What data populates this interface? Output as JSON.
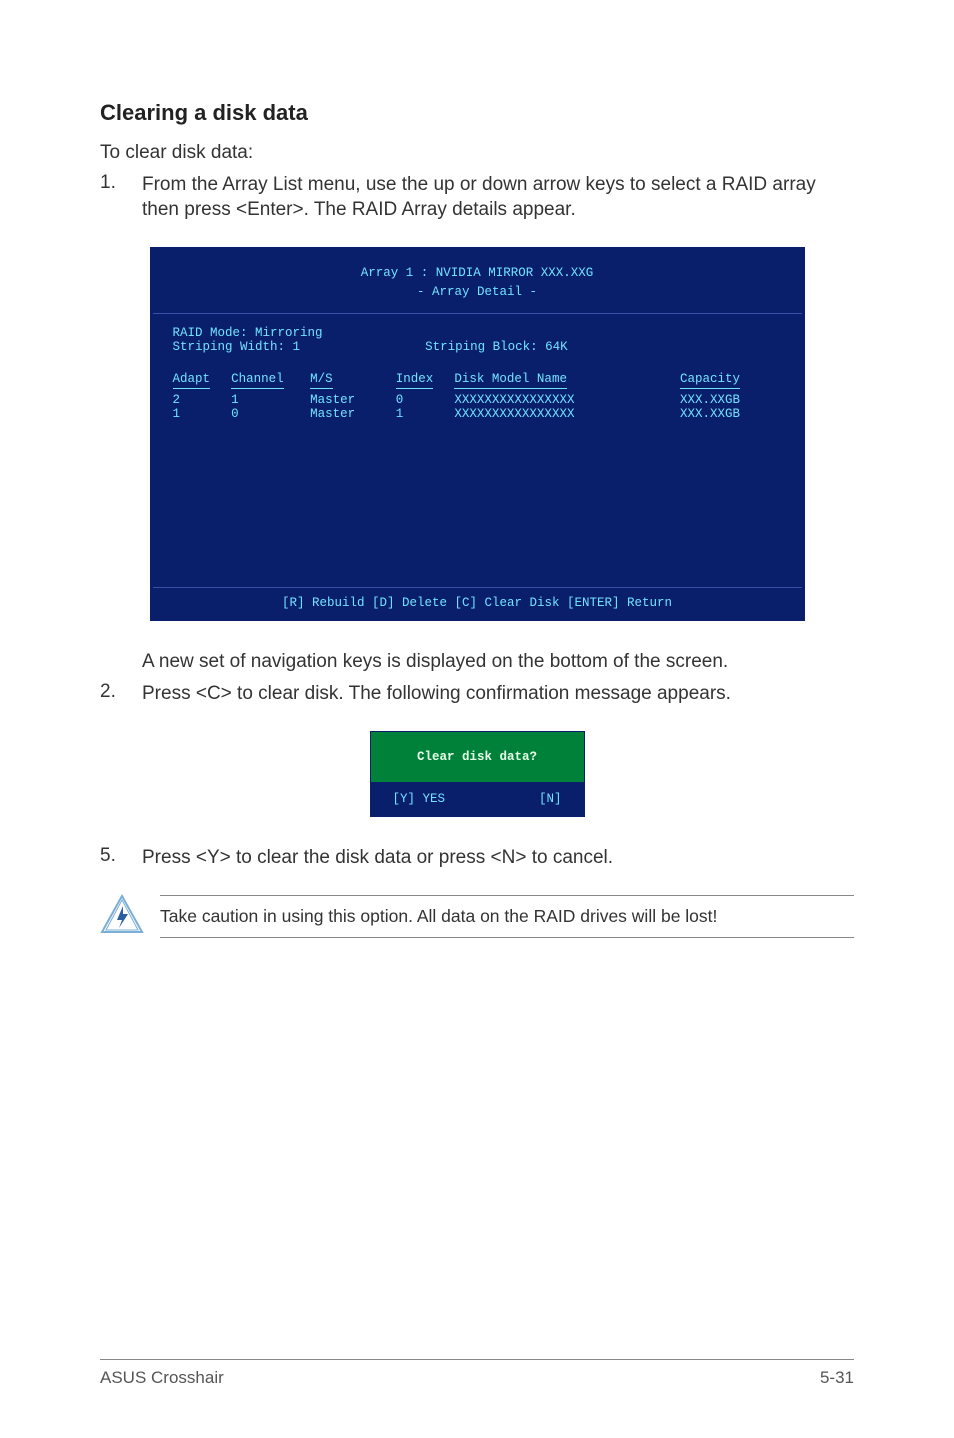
{
  "heading": "Clearing a disk data",
  "intro": "To clear disk data:",
  "steps1": {
    "num": "1.",
    "text": "From the Array List menu, use the up or down arrow keys to select a RAID array then press <Enter>. The RAID Array details appear."
  },
  "bios": {
    "title_line1": "Array 1 : NVIDIA MIRROR  XXX.XXG",
    "title_line2": "- Array Detail -",
    "raid_mode": "RAID Mode: Mirroring",
    "striping_width": "Striping Width: 1",
    "striping_block": "Striping Block: 64K",
    "cols": {
      "adapt": "Adapt",
      "channel": "Channel",
      "ms": "M/S",
      "index": "Index",
      "disk": "Disk Model Name",
      "cap": "Capacity"
    },
    "rows": [
      {
        "adapt": "2",
        "channel": "1",
        "ms": "Master",
        "index": "0",
        "disk": "XXXXXXXXXXXXXXXX",
        "cap": "XXX.XXGB"
      },
      {
        "adapt": "1",
        "channel": "0",
        "ms": "Master",
        "index": "1",
        "disk": "XXXXXXXXXXXXXXXX",
        "cap": "XXX.XXGB"
      }
    ],
    "footer": "[R] Rebuild  [D] Delete  [C] Clear Disk  [ENTER] Return"
  },
  "after_bios": "A new set of  navigation keys is displayed on the bottom of the screen.",
  "steps2": {
    "num": "2.",
    "text": "Press <C> to clear disk. The following confirmation message appears."
  },
  "dialog": {
    "title": "Clear disk data?",
    "yes": "[Y] YES",
    "no": "[N]"
  },
  "steps5": {
    "num": "5.",
    "text": "Press <Y> to clear the disk data or press <N> to cancel."
  },
  "note": "Take caution in using this option. All data on the RAID drives will be lost!",
  "footer": {
    "left": "ASUS Crosshair",
    "right": "5-31"
  }
}
